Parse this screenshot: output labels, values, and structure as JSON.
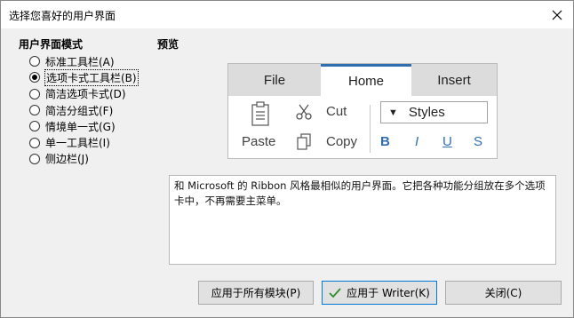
{
  "window": {
    "title": "选择您喜好的用户界面"
  },
  "modes": {
    "heading": "用户界面模式",
    "items": [
      {
        "label": "标准工具栏(A)",
        "checked": false
      },
      {
        "label": "选项卡式工具栏(B)",
        "checked": true
      },
      {
        "label": "简洁选项卡式(D)",
        "checked": false
      },
      {
        "label": "简洁分组式(F)",
        "checked": false
      },
      {
        "label": "情境单一式(G)",
        "checked": false
      },
      {
        "label": "单一工具栏(I)",
        "checked": false
      },
      {
        "label": "侧边栏(J)",
        "checked": false
      }
    ]
  },
  "preview": {
    "heading": "预览",
    "tabs": [
      "File",
      "Home",
      "Insert"
    ],
    "active_tab": "Home",
    "paste_label": "Paste",
    "cut_label": "Cut",
    "copy_label": "Copy",
    "styles_label": "Styles",
    "bold_label": "B",
    "italic_label": "I",
    "underline_label": "U",
    "strike_label": "S",
    "accent_color": "#2f6fb1"
  },
  "description": "和 Microsoft 的 Ribbon 风格最相似的用户界面。它把各种功能分组放在多个选项卡中，不再需要主菜单。",
  "buttons": {
    "apply_all": "应用于所有模块(P)",
    "apply_writer": "应用于 Writer(K)",
    "close": "关闭(C)"
  }
}
